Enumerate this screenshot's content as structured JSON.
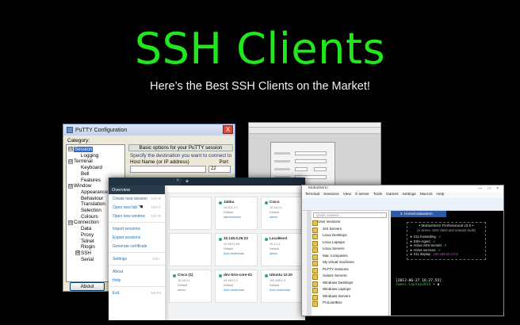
{
  "headline": "SSH Clients",
  "subhead": "Here’s the Best SSH Clients on the Market!",
  "putty": {
    "title": "PuTTY Configuration",
    "close": "X",
    "category_label": "Category:",
    "tree": [
      "Session",
      "Logging",
      "Terminal",
      "Keyboard",
      "Bell",
      "Features",
      "Window",
      "Appearance",
      "Behaviour",
      "Translation",
      "Selection",
      "Colours",
      "Connection",
      "Data",
      "Proxy",
      "Telnet",
      "Rlogin",
      "SSH",
      "Serial"
    ],
    "expanders": [
      "⊟",
      "⊟",
      "⊟",
      "⊟",
      "⊞"
    ],
    "basic_options": "Basic options for your PuTTY session",
    "specify": "Specify the destination you want to connect to",
    "host_label": "Host Name (or IP address)",
    "port_label": "Port",
    "port_value": "22",
    "connection_type": "Connection type:",
    "about_button": "About"
  },
  "termius": {
    "tab_x": "×",
    "plus": "+",
    "overview": "Overview",
    "menu": [
      {
        "label": "Create new session",
        "key": "Ctrl+N"
      },
      {
        "label": "Open new tab",
        "key": "Ctrl+T"
      },
      {
        "label": "Open new window",
        "key": "Ctrl+N"
      },
      {
        "label": "Import sessions",
        "key": ""
      },
      {
        "label": "Export sessions",
        "key": ""
      },
      {
        "label": "Generate certificate",
        "key": ""
      },
      {
        "label": "Settings",
        "key": "Ctrl+,"
      },
      {
        "label": "About",
        "key": ""
      },
      {
        "label": "Help",
        "key": ""
      },
      {
        "label": "Exit",
        "key": "Alt+F4"
      }
    ],
    "cards": [
      {
        "name": "",
        "l1": "",
        "l2": "",
        "l3": "",
        "link": ""
      },
      {
        "name": "Jabba",
        "l1": "10.201.2.1",
        "l2": "Default",
        "l3": "",
        "link": "administrator"
      },
      {
        "name": "Cisco",
        "l1": "10.14.0.1",
        "l2": "Default",
        "l3": "",
        "link": "admin"
      },
      {
        "name": "",
        "l1": "",
        "l2": "",
        "l3": "",
        "link": ""
      },
      {
        "name": "10.140.0.26:22",
        "l1": "10.140.0.26",
        "l2": "Default",
        "l3": "",
        "link": "Add credentials"
      },
      {
        "name": "LocalHost",
        "l1": "10.1.1.1",
        "l2": "Default",
        "l3": "",
        "link": "admin"
      },
      {
        "name": "Cisco (1)",
        "l1": "10.14.0.1",
        "l2": "Default",
        "l3": "admin",
        "link": ""
      },
      {
        "name": "dev-hrm-core-01",
        "l1": "10.140.1.2",
        "l2": "Default",
        "l3": "",
        "link": "Add credentials"
      },
      {
        "name": "Ubuntu 12.10",
        "l1": "192.168.1.4",
        "l2": "Default",
        "l3": "",
        "link": "Add credentials"
      }
    ]
  },
  "moba": {
    "title": "MobaXterm",
    "window_buttons": "— □ ×",
    "menu": [
      "Terminal",
      "Sessions",
      "View",
      "X server",
      "Tools",
      "Games",
      "Settings",
      "Macros",
      "Help"
    ],
    "quick_connect": "Quick connect...",
    "tree": [
      "User sessions",
      "SIS Servers",
      "Linux Desktops",
      "Linux Laptops",
      "Linux Servers",
      "Mac Computers",
      "My virtual machines",
      "PuTTY sessions",
      "Solaris Servers",
      "Windows Desktops",
      "Windows Laptops",
      "Windows Servers",
      "ProLiantBox"
    ],
    "term_tab": "2. Home/mobaxterm",
    "banner_title": "• MobaXterm Professional v3.0 •",
    "banner_sub": "(X server, SSH client and network tools)",
    "banner_rows": [
      {
        "k": "➤ X11-forwarding",
        "v": ": ✔",
        "c": "g"
      },
      {
        "k": "➤ SSH-Agent",
        "v": ": ✔",
        "c": "g"
      },
      {
        "k": "➤ Active SSH tunnels",
        "v": ": 0",
        "c": "g"
      },
      {
        "k": "➤ Active services",
        "v": ": ✔",
        "c": "g"
      },
      {
        "k": "➤ X11 display",
        "v": ": 192.168.20.2:0.0",
        "c": "p"
      }
    ],
    "prompt_date": "[2012-06-27 16:27.55]",
    "prompt_user": "James.Laptop2013",
    "prompt_tail": "~ ▮"
  }
}
